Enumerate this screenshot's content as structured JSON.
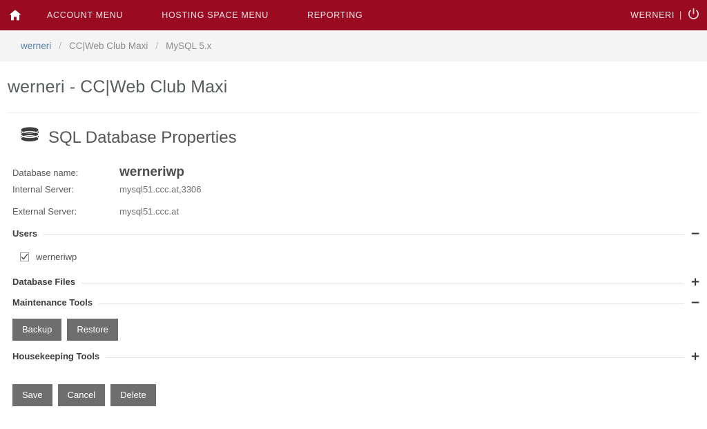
{
  "topnav": {
    "home_icon": "home-icon",
    "items": [
      {
        "label": "ACCOUNT MENU"
      },
      {
        "label": "HOSTING SPACE MENU"
      },
      {
        "label": "REPORTING"
      }
    ],
    "user": "WERNERI",
    "separator": "|",
    "power_icon": "power-icon",
    "bg_color": "#9a0b21",
    "text_color": "#f2e3e6"
  },
  "breadcrumb": {
    "items": [
      {
        "label": "werneri",
        "link": true
      },
      {
        "label": "CC|Web Club Maxi",
        "link": false
      },
      {
        "label": "MySQL 5.x",
        "link": false
      }
    ],
    "separator": "/",
    "link_color": "#5b84b1",
    "bg_color": "#f4f4f4"
  },
  "page": {
    "title": "werneri - CC|Web Club Maxi",
    "section_heading": "SQL Database Properties",
    "section_icon": "database-icon"
  },
  "properties": [
    {
      "label": "Database name:",
      "value": "werneriwp",
      "emphasis": true
    },
    {
      "label": "Internal Server:",
      "value": "mysql51.ccc.at,3306",
      "emphasis": false
    },
    {
      "label": "External Server:",
      "value": "mysql51.ccc.at",
      "emphasis": false
    }
  ],
  "sections": {
    "users": {
      "label": "Users",
      "toggle": "−",
      "toggle_state": "expanded",
      "users": [
        {
          "name": "werneriwp",
          "checked": true
        }
      ]
    },
    "database_files": {
      "label": "Database Files",
      "toggle": "+",
      "toggle_state": "collapsed"
    },
    "maintenance_tools": {
      "label": "Maintenance Tools",
      "toggle": "−",
      "toggle_state": "expanded",
      "buttons": [
        {
          "label": "Backup"
        },
        {
          "label": "Restore"
        }
      ]
    },
    "housekeeping_tools": {
      "label": "Housekeeping Tools",
      "toggle": "+",
      "toggle_state": "collapsed"
    }
  },
  "footer_actions": [
    {
      "label": "Save"
    },
    {
      "label": "Cancel"
    },
    {
      "label": "Delete"
    }
  ],
  "colors": {
    "brand": "#9a0b21",
    "button_gray": "#6e6e6e",
    "link_blue": "#5b84b1"
  }
}
